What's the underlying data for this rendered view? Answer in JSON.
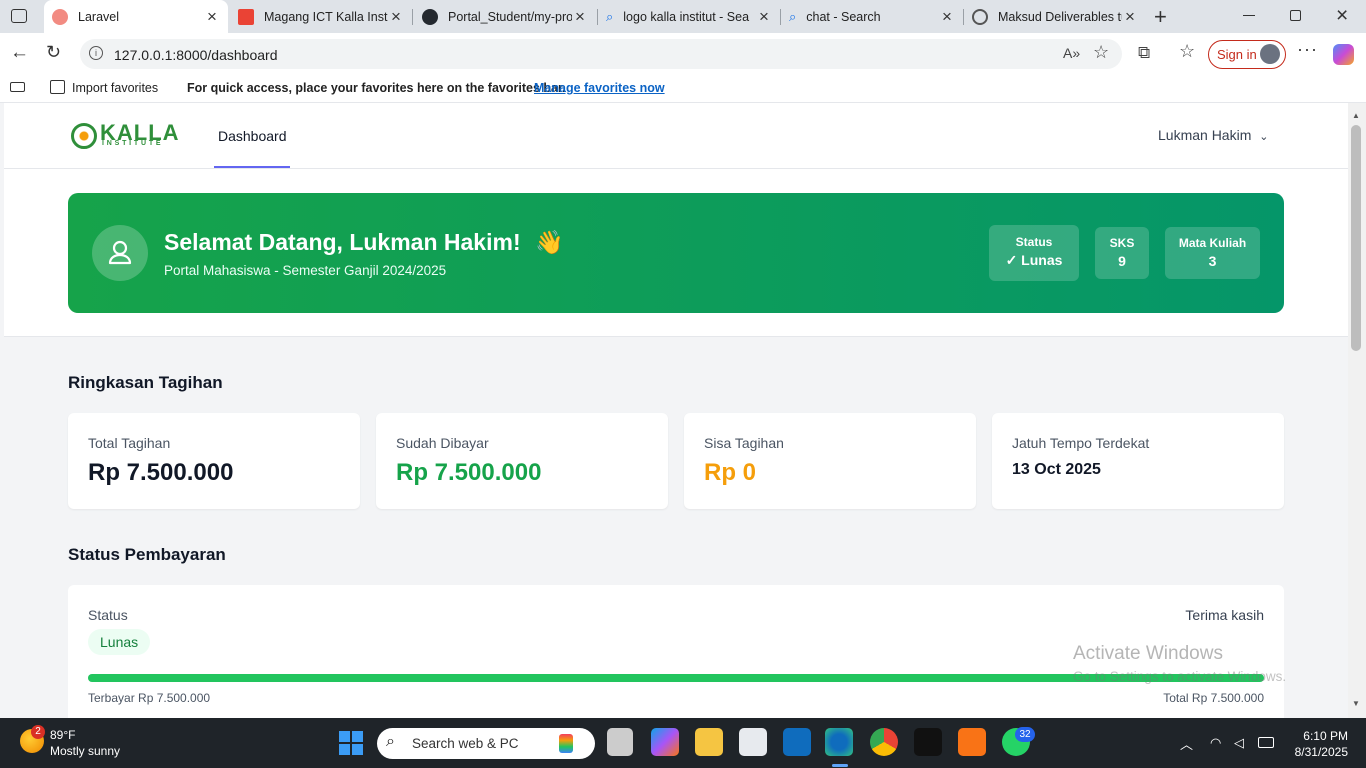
{
  "browser": {
    "tabs": [
      {
        "title": "Laravel",
        "active": true
      },
      {
        "title": "Magang ICT Kalla Instit",
        "active": false
      },
      {
        "title": "Portal_Student/my-proj",
        "active": false
      },
      {
        "title": "logo kalla institut - Sea",
        "active": false
      },
      {
        "title": "chat - Search",
        "active": false
      },
      {
        "title": "Maksud Deliverables tu",
        "active": false
      }
    ],
    "url": "127.0.0.1:8000/dashboard",
    "sign_in": "Sign in",
    "favorites": {
      "import": "Import favorites",
      "hint": "For quick access, place your favorites here on the favorites bar.",
      "manage": "Manage favorites now"
    }
  },
  "app": {
    "logo_main": "KALLA",
    "logo_sub": "INSTITUTE",
    "nav_dashboard": "Dashboard",
    "user_name": "Lukman Hakim",
    "welcome": {
      "title": "Selamat Datang, Lukman Hakim!",
      "emoji": "👋",
      "subtitle": "Portal Mahasiswa - Semester Ganjil 2024/2025",
      "status_label": "Status",
      "status_value": "✓ Lunas",
      "sks_label": "SKS",
      "sks_value": "9",
      "mk_label": "Mata Kuliah",
      "mk_value": "3"
    },
    "summary": {
      "heading": "Ringkasan Tagihan",
      "cards": [
        {
          "label": "Total Tagihan",
          "value": "Rp 7.500.000",
          "color": "#111827"
        },
        {
          "label": "Sudah Dibayar",
          "value": "Rp 7.500.000",
          "color": "#16a34a"
        },
        {
          "label": "Sisa Tagihan",
          "value": "Rp 0",
          "color": "#f59e0b"
        },
        {
          "label": "Jatuh Tempo Terdekat",
          "value": "13 Oct 2025",
          "color": "#111827"
        }
      ]
    },
    "payment": {
      "heading": "Status Pembayaran",
      "status_label": "Status",
      "status_badge": "Lunas",
      "thanks": "Terima kasih",
      "progress": 1.0,
      "paid_text": "Terbayar Rp 7.500.000",
      "total_text": "Total Rp 7.500.000"
    },
    "watermark": {
      "line1": "Activate Windows",
      "line2": "Go to Settings to activate Windows."
    }
  },
  "taskbar": {
    "weather_badge": "2",
    "temp": "89°F",
    "weather": "Mostly sunny",
    "search_placeholder": "Search web & PC",
    "whatsapp_badge": "32",
    "time": "6:10 PM",
    "date": "8/31/2025"
  },
  "colors": {
    "brand_green": "#16a34a",
    "hero_green_end": "#059669",
    "warning": "#f59e0b",
    "nav_underline": "#6366f1"
  }
}
